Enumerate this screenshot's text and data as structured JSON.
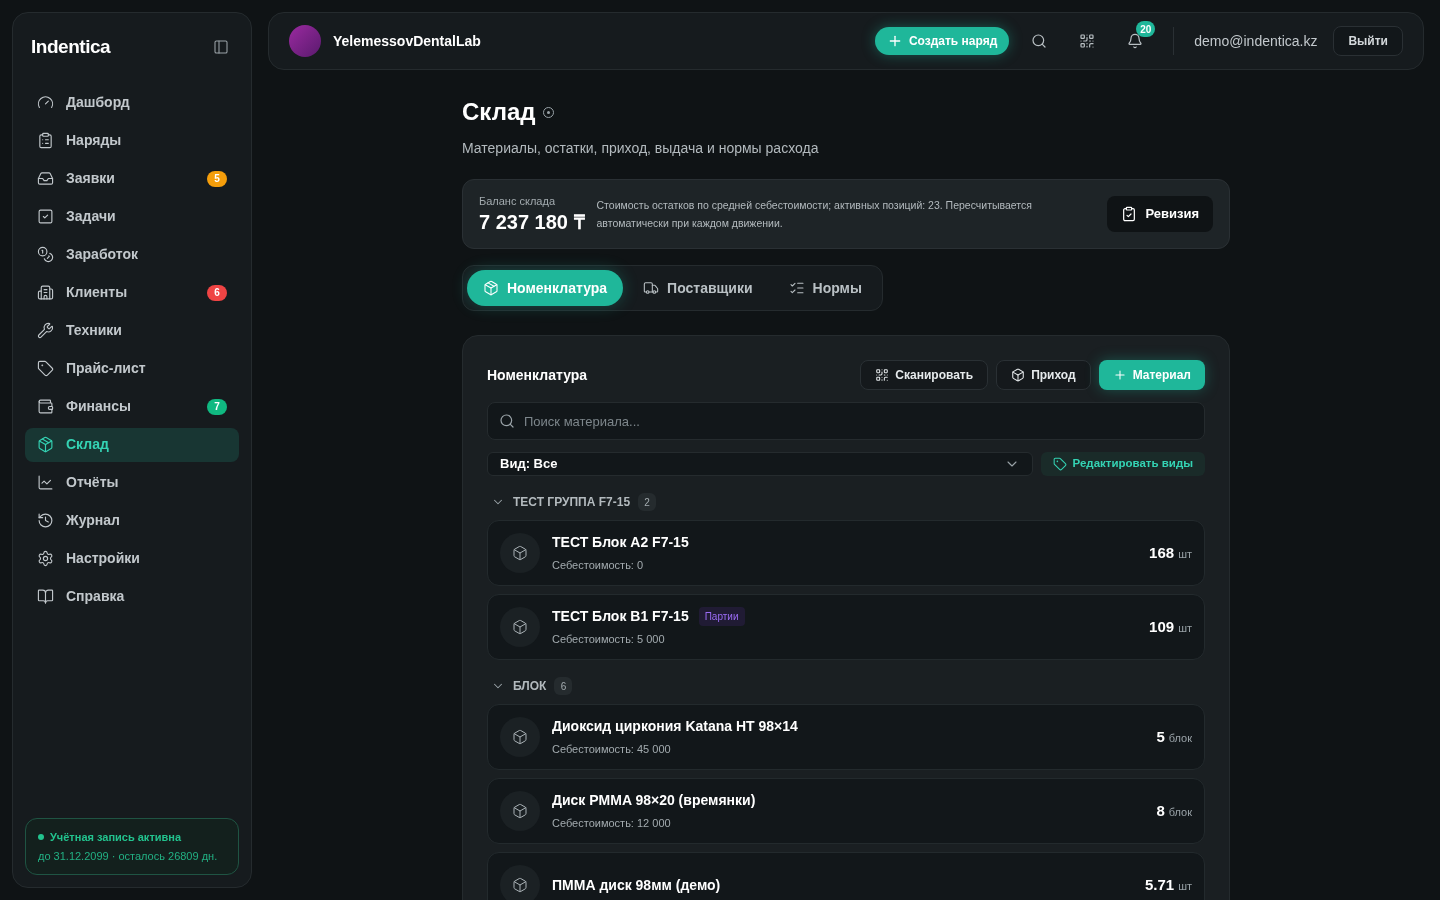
{
  "sidebar": {
    "brand": "Indentica",
    "items": [
      {
        "label": "Дашборд",
        "selected": false
      },
      {
        "label": "Наряды",
        "selected": false
      },
      {
        "label": "Заявки",
        "selected": false,
        "badge": "5",
        "color": "#f59e0b"
      },
      {
        "label": "Задачи",
        "selected": false
      },
      {
        "label": "Заработок",
        "selected": false
      },
      {
        "label": "Клиенты",
        "selected": false,
        "badge": "6",
        "color": "#ef4444"
      },
      {
        "label": "Техники",
        "selected": false
      },
      {
        "label": "Прайс-лист",
        "selected": false
      },
      {
        "label": "Финансы",
        "selected": false,
        "badge": "7",
        "color": "#10b981"
      },
      {
        "label": "Склад",
        "selected": true
      },
      {
        "label": "Отчёты",
        "selected": false
      },
      {
        "label": "Журнал",
        "selected": false
      },
      {
        "label": "Настройки",
        "selected": false
      },
      {
        "label": "Справка",
        "selected": false
      }
    ],
    "account": {
      "status": "Учётная запись активна",
      "details": "до 31.12.2099 · осталось 26809 дн."
    }
  },
  "header": {
    "lab_name": "YelemessovDentalLab",
    "create_button": "Создать наряд",
    "notifications": "20",
    "email": "demo@indentica.kz",
    "logout": "Выйти"
  },
  "page": {
    "title": "Склад",
    "subtitle": "Материалы, остатки, приход, выдача и нормы расхода"
  },
  "balance": {
    "label": "Баланс склада",
    "value": "7 237 180 ₸",
    "note": "Стоимость остатков по средней себестоимости; активных позиций: 23. Пересчитывается автоматически при каждом движении.",
    "button": "Ревизия"
  },
  "tabs": [
    {
      "label": "Номенклатура",
      "selected": true
    },
    {
      "label": "Поставщики",
      "selected": false
    },
    {
      "label": "Нормы",
      "selected": false
    }
  ],
  "panel": {
    "title": "Номенклатура",
    "buttons": [
      {
        "label": "Сканировать",
        "kind": "scan"
      },
      {
        "label": "Приход",
        "kind": "receive"
      },
      {
        "label": "Материал",
        "kind": "add"
      }
    ],
    "search": {
      "placeholder": "Поиск материала..."
    },
    "filter": {
      "value": "Вид: Все"
    },
    "edit_types": "Редактировать виды",
    "groups": [
      {
        "name": "ТЕСТ ГРУППА F7-15",
        "count": "2",
        "expanded": true,
        "items": [
          {
            "name": "ТЕСТ Блок A2 F7-15",
            "cost": "Себестоимость: 0",
            "qty": "168",
            "unit": "шт"
          },
          {
            "name": "ТЕСТ Блок B1 F7-15",
            "tag": "Партии",
            "cost": "Себестоимость: 5 000",
            "qty": "109",
            "unit": "шт"
          }
        ]
      },
      {
        "name": "БЛОК",
        "count": "6",
        "expanded": true,
        "items": [
          {
            "name": "Диоксид циркония Katana HT 98×14",
            "cost": "Себестоимость: 45 000",
            "qty": "5",
            "unit": "блок"
          },
          {
            "name": "Диск PMMA 98×20 (времянки)",
            "cost": "Себестоимость: 12 000",
            "qty": "8",
            "unit": "блок"
          },
          {
            "name": "ПММА диск 98мм (демо)",
            "qty": "5.71",
            "unit": "шт"
          }
        ]
      }
    ]
  }
}
